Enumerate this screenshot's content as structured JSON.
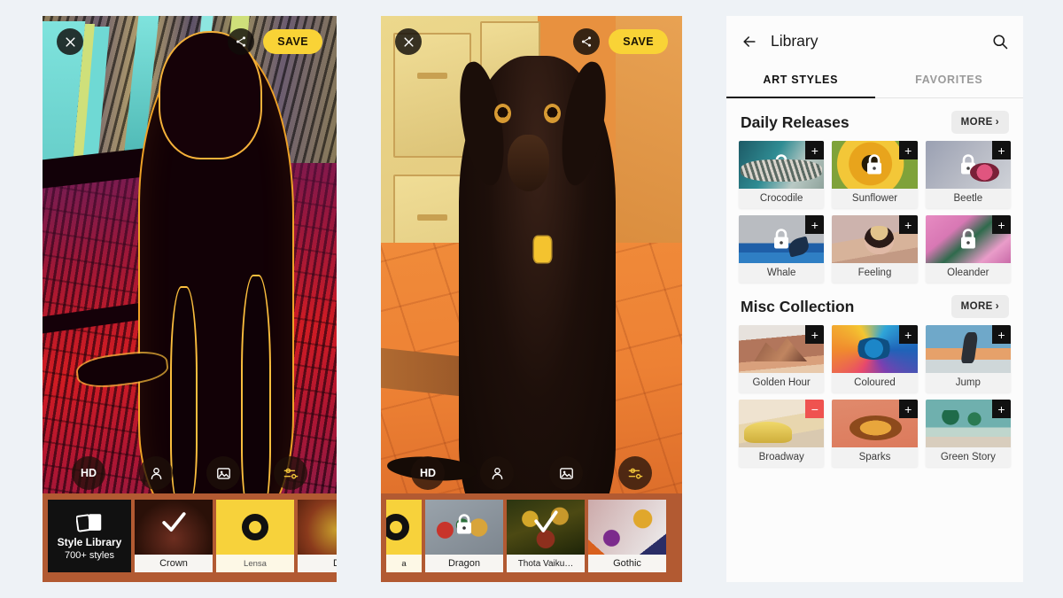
{
  "editor_left": {
    "top_bar": {
      "close_icon": "close-icon",
      "share_icon": "share-icon",
      "save_label": "SAVE"
    },
    "tools": [
      {
        "icon": "hd-icon",
        "label": "HD"
      },
      {
        "icon": "person-icon",
        "label": ""
      },
      {
        "icon": "image-icon",
        "label": ""
      },
      {
        "icon": "sliders-icon",
        "label": ""
      }
    ],
    "library_card": {
      "title": "Style Library",
      "subtitle": "700+ styles",
      "icon": "photo-stack-icon"
    },
    "styles": [
      {
        "name": "Crown",
        "state": "selected"
      },
      {
        "name": "Lensa",
        "state": "none"
      },
      {
        "name": "D",
        "state": "none"
      }
    ]
  },
  "editor_right": {
    "top_bar": {
      "close_icon": "close-icon",
      "share_icon": "share-icon",
      "save_label": "SAVE"
    },
    "tools": [
      {
        "icon": "hd-icon",
        "label": "HD"
      },
      {
        "icon": "person-icon",
        "label": ""
      },
      {
        "icon": "image-icon",
        "label": ""
      },
      {
        "icon": "sliders-icon",
        "label": ""
      }
    ],
    "styles": [
      {
        "name": "a",
        "state": "none"
      },
      {
        "name": "Dragon",
        "state": "locked"
      },
      {
        "name": "Thota Vaiku…",
        "state": "selected"
      },
      {
        "name": "Gothic",
        "state": "none"
      }
    ]
  },
  "library": {
    "back_icon": "back-arrow-icon",
    "title": "Library",
    "search_icon": "search-icon",
    "tabs": [
      {
        "label": "ART STYLES",
        "active": true
      },
      {
        "label": "FAVORITES",
        "active": false
      }
    ],
    "sections": [
      {
        "title": "Daily Releases",
        "more_label": "MORE",
        "items": [
          {
            "name": "Crocodile",
            "badge": "+",
            "locked": true,
            "art": "a-croc"
          },
          {
            "name": "Sunflower",
            "badge": "+",
            "locked": true,
            "art": "a-sun"
          },
          {
            "name": "Beetle",
            "badge": "+",
            "locked": true,
            "art": "a-beet"
          },
          {
            "name": "Whale",
            "badge": "+",
            "locked": true,
            "art": "a-whale"
          },
          {
            "name": "Feeling",
            "badge": "+",
            "locked": true,
            "art": "a-feel"
          },
          {
            "name": "Oleander",
            "badge": "+",
            "locked": true,
            "art": "a-olea"
          }
        ]
      },
      {
        "title": "Misc Collection",
        "more_label": "MORE",
        "items": [
          {
            "name": "Golden Hour",
            "badge": "+",
            "locked": false,
            "art": "a-gold"
          },
          {
            "name": "Coloured",
            "badge": "+",
            "locked": false,
            "art": "a-col"
          },
          {
            "name": "Jump",
            "badge": "+",
            "locked": false,
            "art": "a-jump"
          },
          {
            "name": "Broadway",
            "badge": "−",
            "locked": false,
            "art": "a-broad"
          },
          {
            "name": "Sparks",
            "badge": "+",
            "locked": false,
            "art": "a-spark"
          },
          {
            "name": "Green Story",
            "badge": "+",
            "locked": false,
            "art": "a-green"
          }
        ]
      }
    ]
  },
  "colors": {
    "accent_yellow": "#f9d336",
    "background": "#eef2f6",
    "carousel_bar": "#b25a32",
    "badge_dark": "#111111",
    "badge_red": "#ef5350"
  }
}
